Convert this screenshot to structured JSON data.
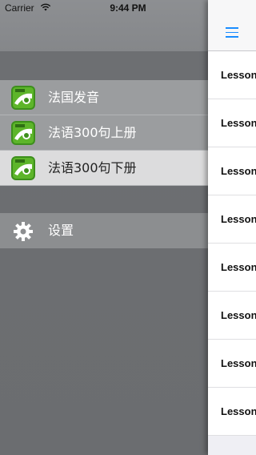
{
  "status_bar": {
    "carrier": "Carrier",
    "time": "9:44 PM"
  },
  "drawer": {
    "books": [
      {
        "label": "法国发音",
        "selected": false
      },
      {
        "label": "法语300句上册",
        "selected": false
      },
      {
        "label": "法语300句下册",
        "selected": true
      }
    ],
    "settings": {
      "label": "设置"
    }
  },
  "content": {
    "lessons": [
      "Lesson",
      "Lesson",
      "Lesson",
      "Lesson",
      "Lesson",
      "Lesson",
      "Lesson",
      "Lesson"
    ]
  },
  "colors": {
    "accent": "#1a8dff",
    "icon_green": "#3d8f1c"
  },
  "icons": {
    "menu": "hamburger-icon",
    "settings": "gear-icon",
    "book": "book-app-icon"
  }
}
